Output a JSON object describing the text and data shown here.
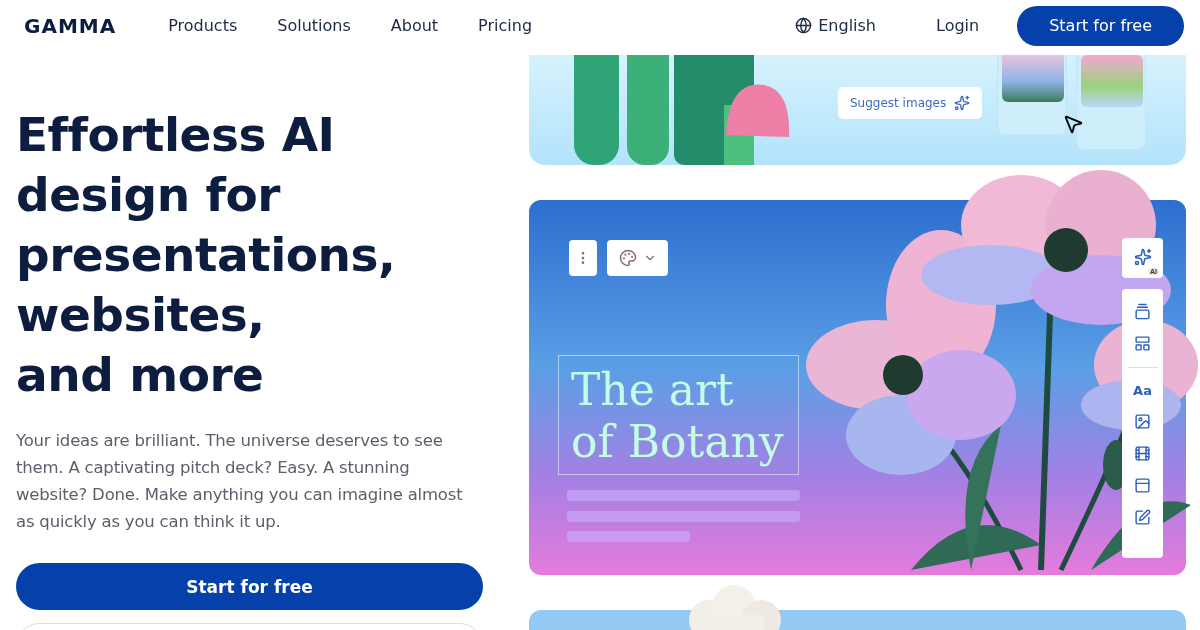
{
  "nav": {
    "logo": "GAMMA",
    "links": [
      "Products",
      "Solutions",
      "About",
      "Pricing"
    ],
    "language": "English",
    "login": "Login",
    "cta": "Start for free"
  },
  "hero": {
    "headline_lines": [
      "Effortless AI",
      "design for",
      "presentations,",
      "websites,",
      "and more"
    ],
    "body": "Your ideas are brilliant. The universe deserves to see them. A captivating pitch deck? Easy. A stunning website? Done. Make anything you can imagine almost as quickly as you can think it up.",
    "cta": "Start for free"
  },
  "showcase": {
    "suggest_button": "Suggest images",
    "slide_title_lines": [
      "The art",
      "of Botany"
    ],
    "ai_badge": "AI",
    "text_tool": "Aa"
  }
}
